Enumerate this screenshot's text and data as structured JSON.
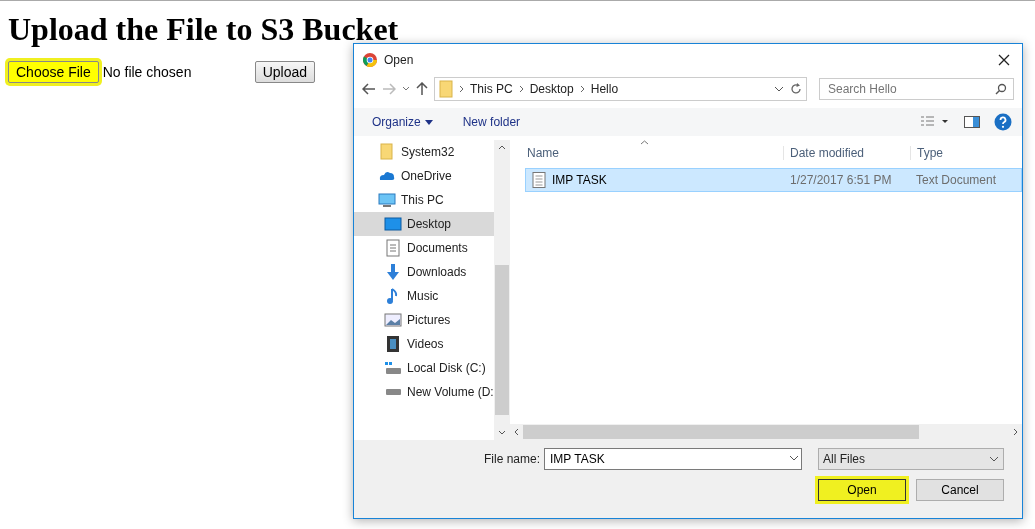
{
  "page": {
    "heading": "Upload the File to S3 Bucket",
    "choose_button": {
      "label": "Choose File",
      "highlighted": true
    },
    "file_status": "No file chosen",
    "upload_button": {
      "label": "Upload",
      "highlighted": false
    }
  },
  "dialog": {
    "title": "Open",
    "breadcrumb": [
      "This PC",
      "Desktop",
      "Hello"
    ],
    "search": {
      "placeholder": "Search Hello"
    },
    "toolbar": {
      "organize": "Organize",
      "new_folder": "New folder"
    },
    "nav": [
      {
        "label": "System32",
        "kind": "folder",
        "selected": false
      },
      {
        "label": "OneDrive",
        "kind": "cloud",
        "selected": false
      },
      {
        "label": "This PC",
        "kind": "pc",
        "selected": false,
        "children": [
          {
            "label": "Desktop",
            "kind": "desktop",
            "selected": true
          },
          {
            "label": "Documents",
            "kind": "documents",
            "selected": false
          },
          {
            "label": "Downloads",
            "kind": "downloads",
            "selected": false
          },
          {
            "label": "Music",
            "kind": "music",
            "selected": false
          },
          {
            "label": "Pictures",
            "kind": "pictures",
            "selected": false
          },
          {
            "label": "Videos",
            "kind": "videos",
            "selected": false
          },
          {
            "label": "Local Disk (C:)",
            "kind": "disk",
            "selected": false
          },
          {
            "label": "New Volume (D:",
            "kind": "drive",
            "selected": false
          }
        ]
      }
    ],
    "columns": [
      "Name",
      "Date modified",
      "Type"
    ],
    "rows": [
      {
        "name": "IMP TASK",
        "date": "1/27/2017 6:51 PM",
        "type": "Text Document",
        "selected": true
      }
    ],
    "file_name": {
      "label": "File name:",
      "value": "IMP TASK"
    },
    "file_type": "All Files",
    "open_button": {
      "label": "Open",
      "highlighted": true
    },
    "cancel_button": {
      "label": "Cancel",
      "highlighted": false
    }
  }
}
